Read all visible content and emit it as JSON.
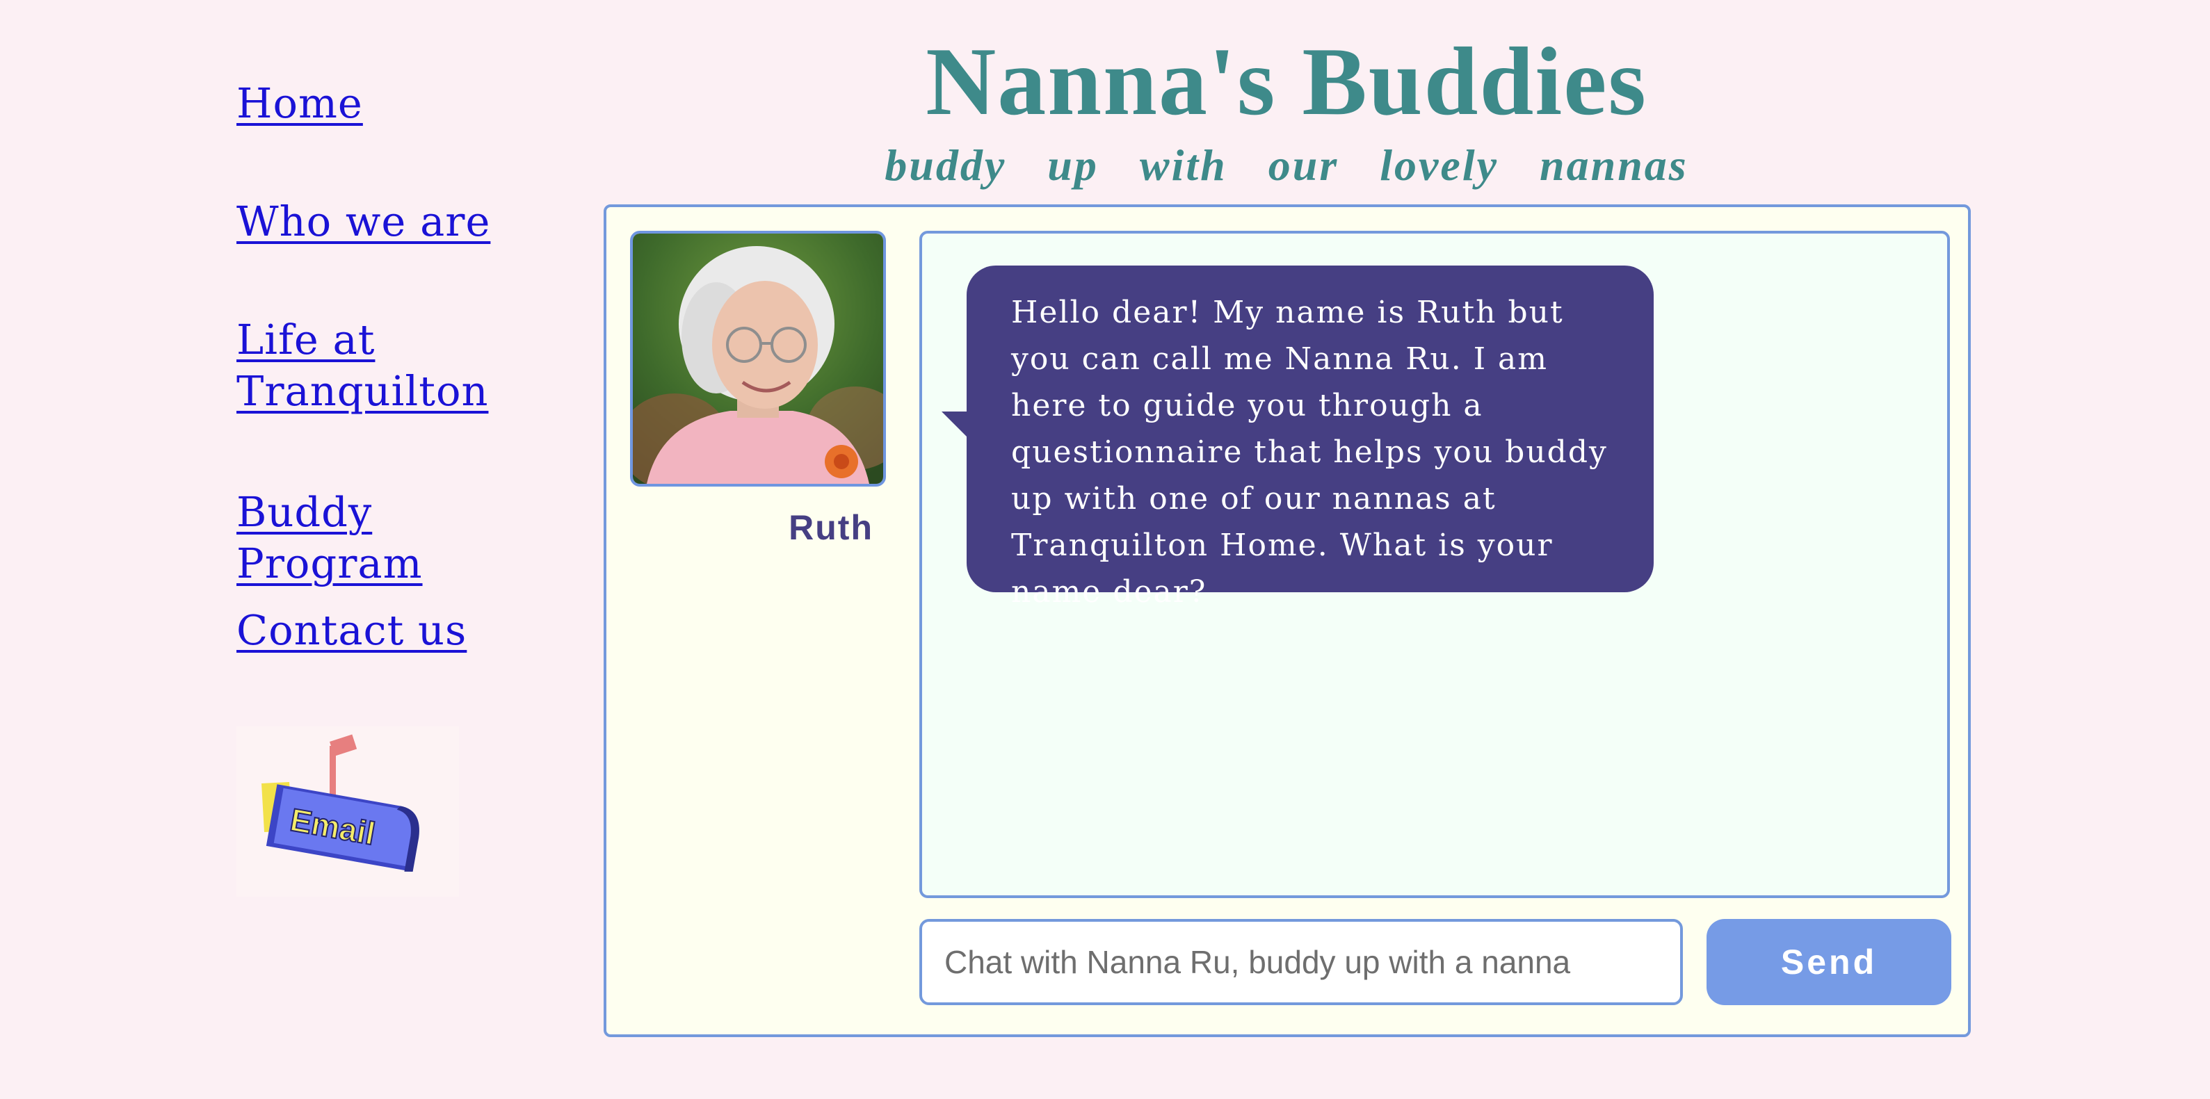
{
  "nav": {
    "items": [
      {
        "label": "Home"
      },
      {
        "label": "Who we are"
      },
      {
        "label": "Life at Tranquilton"
      },
      {
        "label": "Buddy Program"
      },
      {
        "label": "Contact us"
      }
    ],
    "email_icon": {
      "name": "mailbox-icon",
      "label": "Email"
    }
  },
  "header": {
    "title": "Nanna's Buddies",
    "tagline": "buddy up with our lovely nannas"
  },
  "chat": {
    "avatar_name": "Ruth",
    "messages": [
      {
        "sender": "Ruth",
        "text": "Hello dear! My name is Ruth but you can call me Nanna Ru. I am here to guide you through a questionnaire that helps you buddy up with one of our nannas at Tranquilton Home. What is your name dear?"
      }
    ],
    "input_placeholder": "Chat with Nanna Ru, buddy up with a nanna",
    "input_value": "",
    "send_label": "Send"
  },
  "colors": {
    "background": "#fcf0f4",
    "accent_teal": "#3e8a8a",
    "link_blue": "#1a12d6",
    "bubble_purple": "#463f83",
    "border_blue": "#7399dc",
    "button_blue": "#769be6"
  }
}
